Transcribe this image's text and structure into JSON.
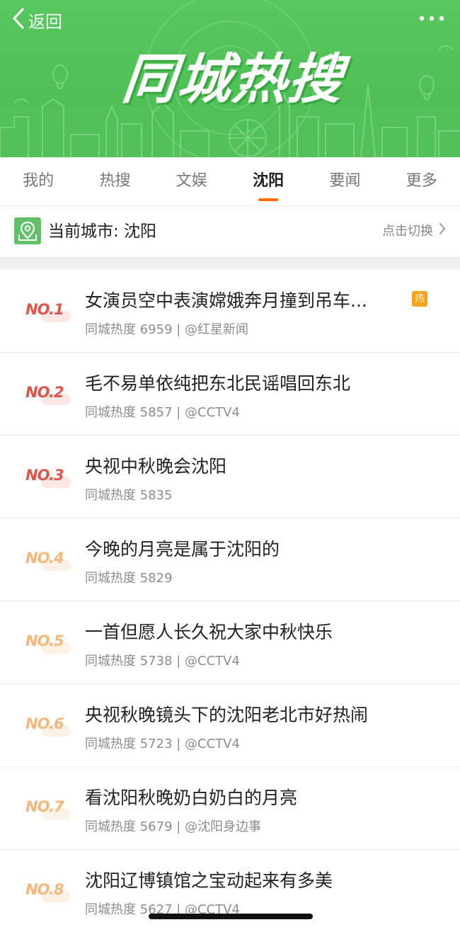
{
  "header": {
    "back_label": "返回",
    "banner_title": "同城热搜"
  },
  "tabs": [
    {
      "label": "我的",
      "active": false
    },
    {
      "label": "热搜",
      "active": false
    },
    {
      "label": "文娱",
      "active": false
    },
    {
      "label": "沈阳",
      "active": true
    },
    {
      "label": "要闻",
      "active": false
    },
    {
      "label": "更多",
      "active": false
    }
  ],
  "city": {
    "label": "当前城市: 沈阳",
    "switch_label": "点击切换"
  },
  "hot_badge": "热",
  "items": [
    {
      "rank": "NO.1",
      "title": "女演员空中表演嫦娥奔月撞到吊车...",
      "meta": "同城热度 6959 | @红星新闻",
      "hot": true
    },
    {
      "rank": "NO.2",
      "title": "毛不易单依纯把东北民谣唱回东北",
      "meta": "同城热度 5857 | @CCTV4",
      "hot": false
    },
    {
      "rank": "NO.3",
      "title": "央视中秋晚会沈阳",
      "meta": "同城热度 5835",
      "hot": false
    },
    {
      "rank": "NO.4",
      "title": "今晚的月亮是属于沈阳的",
      "meta": "同城热度 5829",
      "hot": false
    },
    {
      "rank": "NO.5",
      "title": "一首但愿人长久祝大家中秋快乐",
      "meta": "同城热度 5738 | @CCTV4",
      "hot": false
    },
    {
      "rank": "NO.6",
      "title": "央视秋晚镜头下的沈阳老北市好热闹",
      "meta": "同城热度 5723 | @CCTV4",
      "hot": false
    },
    {
      "rank": "NO.7",
      "title": "看沈阳秋晚奶白奶白的月亮",
      "meta": "同城热度 5679 | @沈阳身边事",
      "hot": false
    },
    {
      "rank": "NO.8",
      "title": "沈阳辽博镇馆之宝动起来有多美",
      "meta": "同城热度 5627 | @CCTV4",
      "hot": false
    }
  ],
  "colors": {
    "banner_green": "#52c159",
    "tab_underline": "#ff6a00",
    "rank_top3": "#e0544a",
    "rank_rest": "#f5b77a",
    "hot_badge": "#f7a21b"
  },
  "icons": {
    "back": "chevron-left-icon",
    "more": "more-horizontal-icon",
    "city": "location-pin-icon",
    "switch": "chevron-right-icon"
  }
}
